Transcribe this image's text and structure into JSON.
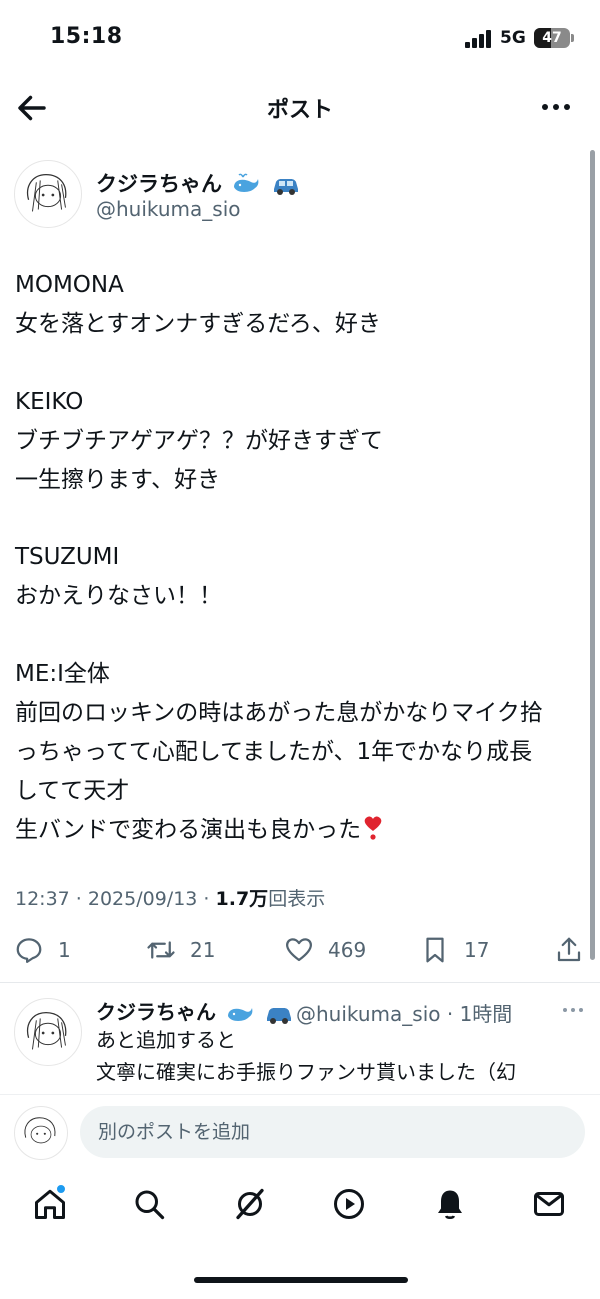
{
  "status_bar": {
    "time": "15:18",
    "network": "5G",
    "battery": "47"
  },
  "header": {
    "title": "ポスト",
    "back_icon": "arrow-left-icon",
    "more_icon": "more-horizontal-icon"
  },
  "post": {
    "author_name": "クジラちゃん",
    "author_emojis": [
      "whale-emoji",
      "car-emoji"
    ],
    "handle": "@huikuma_sio",
    "body": "MOMONA\n女を落とすオンナすぎるだろ、好き\n\nKEIKO\nブチブチアゲアゲ？？が好きすぎて\n一生擦ります、好き\n\nTSUZUMI\nおかえりなさい！！\n\nME:I全体\n前回のロッキンの時はあがった息がかなりマイク拾\nっちゃってて心配してましたが、1年でかなり成長\nしてて天才\n生バンドで変わる演出も良かった",
    "heart_emoji": "red-heart-exclamation-emoji",
    "timestamp": "12:37 · 2025/09/13 · ",
    "views_count": "1.7万",
    "views_label": "回表示",
    "counts": {
      "replies": "1",
      "reposts": "21",
      "likes": "469",
      "bookmarks": "17"
    }
  },
  "reply": {
    "author_name": "クジラちゃん",
    "handle_time": "@huikuma_sio · 1時間",
    "text": "あと追加すると\n文寧に確実にお手振りファンサ貰いました（幻"
  },
  "compose": {
    "placeholder": "別のポストを追加"
  },
  "bottom_nav": {
    "items": [
      "home-icon",
      "search-icon",
      "grok-icon",
      "video-icon",
      "notifications-icon",
      "messages-icon"
    ]
  },
  "colors": {
    "accent": "#1d9bf0",
    "text": "#0f1419",
    "secondary": "#536471"
  }
}
